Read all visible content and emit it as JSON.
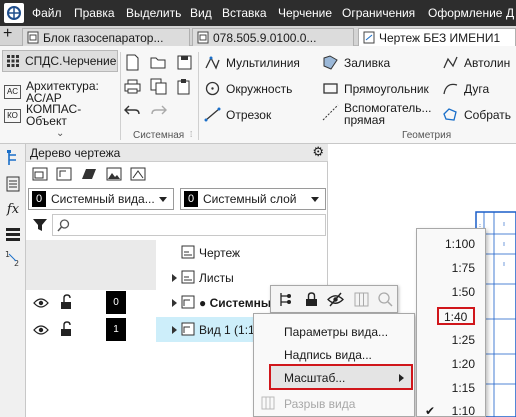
{
  "menubar": {
    "items": [
      "Файл",
      "Правка",
      "Выделить",
      "Вид",
      "Вставка",
      "Черчение",
      "Ограничения",
      "Оформление",
      "Д"
    ]
  },
  "tabs": [
    {
      "label": "Блок газосепаратор..."
    },
    {
      "label": "078.505.9.0100.0..."
    },
    {
      "label": "Чертеж БЕЗ ИМЕНИ1"
    }
  ],
  "ribbon": {
    "spds_label": "СПДС.Черчение",
    "arch_prefix": "АС",
    "arch_label_1": "Архитектура:",
    "arch_label_2": "АС/АР",
    "compass_prefix": "КО",
    "compass_label_1": "КОМПАС-",
    "compass_label_2": "Объект",
    "group_system": "Системная",
    "group_geometry": "Геометрия",
    "tools": {
      "multiline": "Мультилиния",
      "circle": "Окружность",
      "segment": "Отрезок",
      "fill": "Заливка",
      "rectangle": "Прямоугольник",
      "aux_line_1": "Вспомогатель...",
      "aux_line_2": "прямая",
      "autoline": "Автолин",
      "arc": "Дуга",
      "collect": "Собрать"
    }
  },
  "tree": {
    "title": "Дерево чертежа",
    "view_select": {
      "number": "0",
      "value": "Системный вида..."
    },
    "layer_select": {
      "number": "0",
      "value": "Системный слой"
    },
    "search_placeholder": "",
    "rows": {
      "drawing": "Чертеж",
      "sheets": "Листы",
      "system_view": "● Системны",
      "system_view_num": "0",
      "view1": "Вид 1 (1:10",
      "view1_num": "1"
    }
  },
  "context_menu": {
    "items": {
      "params": "Параметры вида...",
      "label": "Надпись вида...",
      "scale": "Масштаб...",
      "break": "Разрыв вида"
    }
  },
  "scale_menu": {
    "items": [
      "1:100",
      "1:75",
      "1:50",
      "1:40",
      "1:25",
      "1:20",
      "1:15",
      "1:10"
    ],
    "highlighted": "1:40",
    "checked": "1:10"
  },
  "colors": {
    "menubar_bg": "#2d2d2d",
    "highlight_border": "#d0161b",
    "selected_row": "#cdeefa",
    "accent_blue": "#1a6fc9"
  }
}
